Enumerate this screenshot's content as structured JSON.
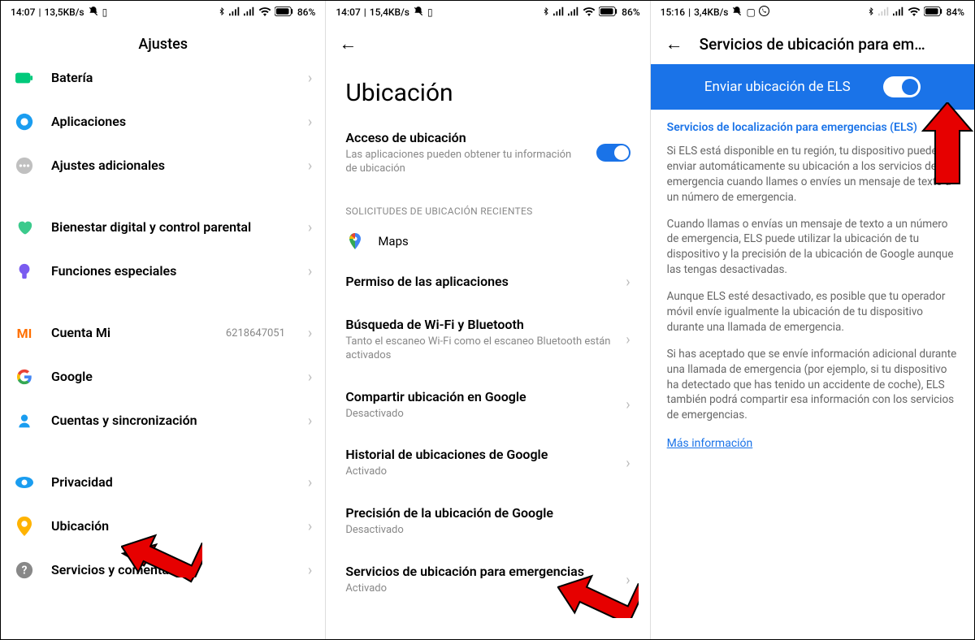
{
  "screen1": {
    "status": {
      "time": "14:07",
      "speed": "13,5KB/s",
      "battery": "86%"
    },
    "title": "Ajustes",
    "items": [
      {
        "label": "Batería",
        "icon": "battery",
        "color": "#00c97b"
      },
      {
        "label": "Aplicaciones",
        "icon": "apps",
        "color": "#1a9df0"
      },
      {
        "label": "Ajustes adicionales",
        "icon": "dots",
        "color": "#b0b0b0"
      }
    ],
    "items2": [
      {
        "label": "Bienestar digital y control parental",
        "icon": "wellbeing",
        "color": "#3bca8c"
      },
      {
        "label": "Funciones especiales",
        "icon": "special",
        "color": "#7a5cf0"
      }
    ],
    "items3": [
      {
        "label": "Cuenta Mi",
        "value": "6218647051",
        "icon": "mi",
        "color": "#ff6f00"
      },
      {
        "label": "Google",
        "icon": "google"
      },
      {
        "label": "Cuentas y sincronización",
        "icon": "account",
        "color": "#1a9df0"
      }
    ],
    "items4": [
      {
        "label": "Privacidad",
        "icon": "eye",
        "color": "#1a9df0"
      },
      {
        "label": "Ubicación",
        "icon": "location",
        "color": "#ffb300"
      },
      {
        "label": "Servicios y comentarios",
        "icon": "help",
        "color": "#888"
      }
    ]
  },
  "screen2": {
    "status": {
      "time": "14:07",
      "speed": "15,4KB/s",
      "battery": "86%"
    },
    "title": "Ubicación",
    "access": {
      "title": "Acceso de ubicación",
      "sub": "Las aplicaciones pueden obtener tu información de ubicación"
    },
    "recent_header": "SOLICITUDES DE UBICACIÓN RECIENTES",
    "recent_app": "Maps",
    "rows": [
      {
        "title": "Permiso de las aplicaciones"
      },
      {
        "title": "Búsqueda de Wi-Fi y Bluetooth",
        "sub": "Tanto el escaneo Wi-Fi como el escaneo Bluetooth están activados"
      },
      {
        "title": "Compartir ubicación en Google",
        "sub": "Desactivado"
      },
      {
        "title": "Historial de ubicaciones de Google",
        "sub": "Activado"
      },
      {
        "title": "Precisión de la ubicación de Google",
        "sub": "Desactivado"
      },
      {
        "title": "Servicios de ubicación para emergencias",
        "sub": "Activado"
      }
    ]
  },
  "screen3": {
    "status": {
      "time": "15:16",
      "speed": "3,4KB/s",
      "battery": "84%"
    },
    "title": "Servicios de ubicación para em…",
    "toggle_label": "Enviar ubicación de ELS",
    "info_title": "Servicios de localización para emergencias (ELS)",
    "p1": "Si ELS está disponible en tu región, tu dispositivo puede enviar automáticamente su ubicación a los servicios de emergencia cuando llames o envíes un mensaje de texto a un número de emergencia.",
    "p2": "Cuando llamas o envías un mensaje de texto a un número de emergencia, ELS puede utilizar la ubicación de tu dispositivo y la precisión de la ubicación de Google aunque las tengas desactivadas.",
    "p3": "Aunque ELS esté desactivado, es posible que tu operador móvil envíe igualmente la ubicación de tu dispositivo durante una llamada de emergencia.",
    "p4": "Si has aceptado que se envíe información adicional durante una llamada de emergencia (por ejemplo, si tu dispositivo ha detectado que has tenido un accidente de coche), ELS también podrá compartir esa información con los servicios de emergencias.",
    "link": "Más información"
  }
}
